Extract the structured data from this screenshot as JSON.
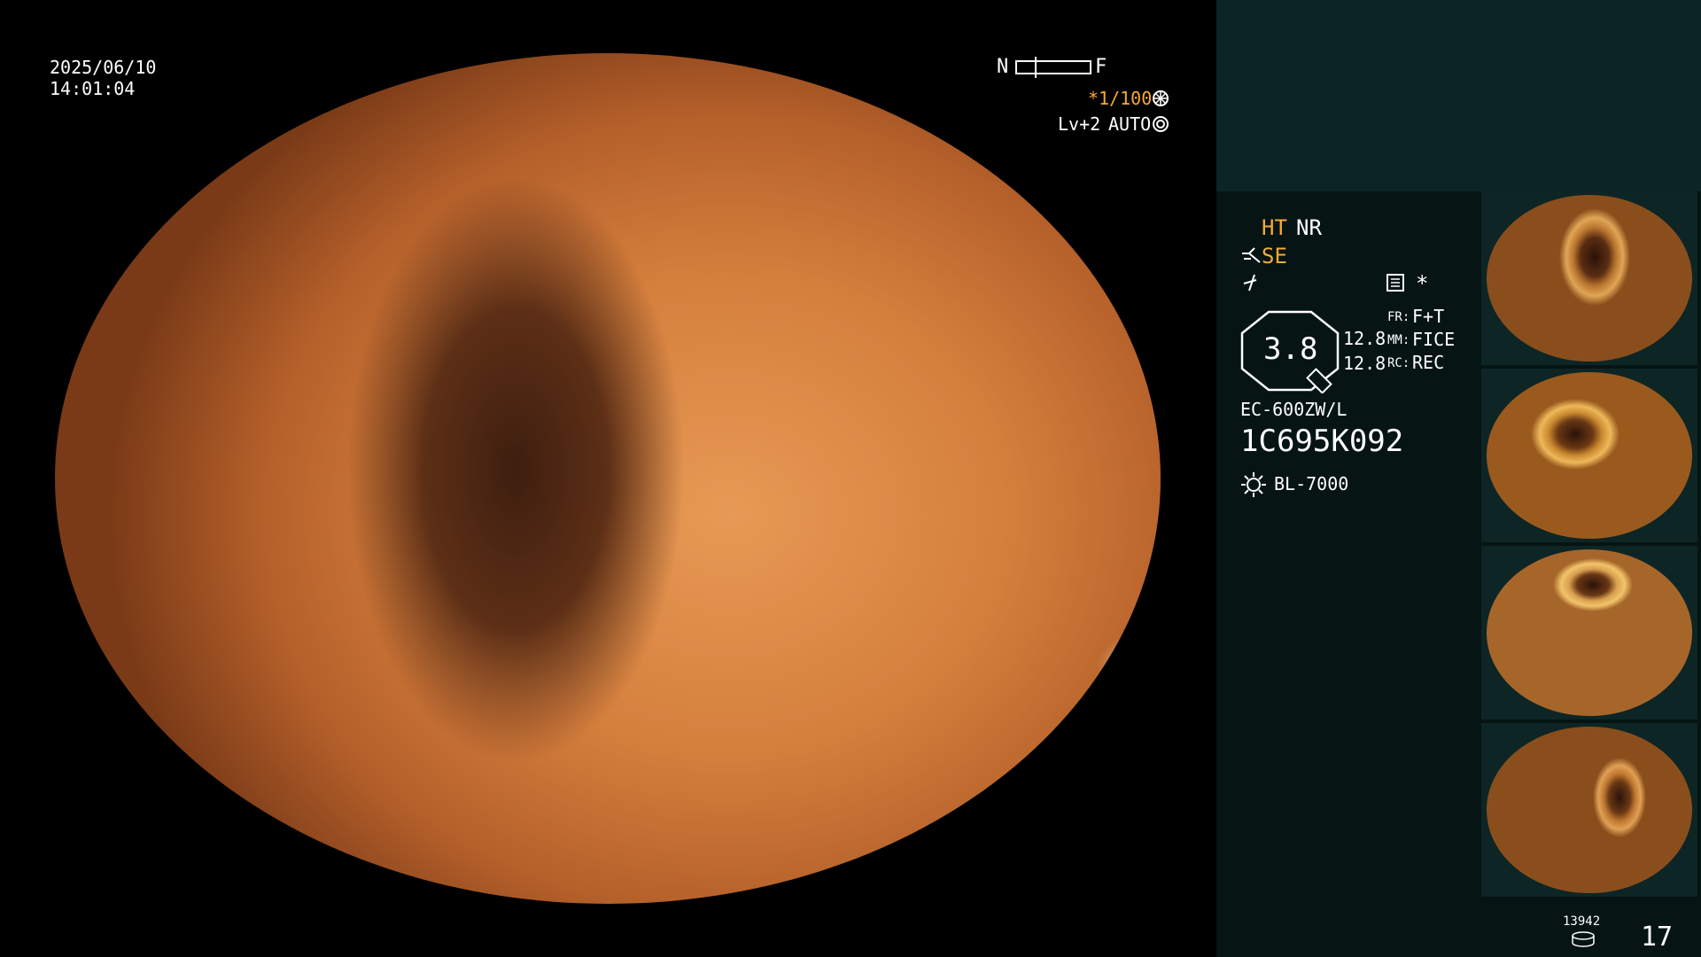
{
  "osd": {
    "date": "2025/06/10",
    "time": "14:01:04",
    "focus_near": "N",
    "focus_far": "F",
    "shutter": "*1/100",
    "level": "Lv+2",
    "iris": "AUTO"
  },
  "panel": {
    "ht": "HT",
    "nr": "NR",
    "se": "SE",
    "star": "*",
    "zoom": "3.8",
    "val1": "12.8",
    "val2": "12.8",
    "fr_label": "FR:",
    "fr_value": "F+T",
    "mm_label": "MM:",
    "mm_value": "FICE",
    "rc_label": "RC:",
    "rc_value": "REC",
    "scope_model": "EC-600ZW/L",
    "scope_serial": "1C695K092",
    "light_source": "BL-7000",
    "storage_count": "13942",
    "image_count": "17"
  },
  "colors": {
    "accent_orange": "#f6a93a",
    "panel_bg": "#061414",
    "panel_top_bg": "#0c2424"
  },
  "icons": [
    "shutter-icon",
    "iris-icon",
    "scissors-icon",
    "lightning-icon",
    "settings-icon",
    "zoom-magnifier-icon",
    "light-source-icon",
    "storage-icon"
  ]
}
